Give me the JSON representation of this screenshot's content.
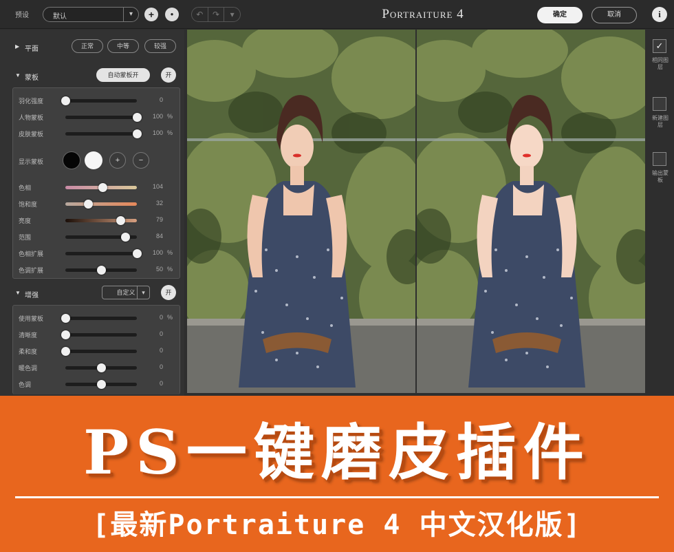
{
  "toolbar": {
    "preset_label": "预设",
    "preset_value": "默认",
    "preset_caret": "▾",
    "add_symbol": "+",
    "settings_symbol": "●",
    "undo_symbol": "↶",
    "redo_symbol": "↷",
    "history_symbol": "▾",
    "app_title": "Portraiture 4",
    "ok_label": "确定",
    "cancel_label": "取消",
    "info_symbol": "i"
  },
  "panel": {
    "tone": {
      "name": "平面",
      "buttons": [
        "正常",
        "中等",
        "较强"
      ]
    },
    "mask": {
      "name": "蒙板",
      "auto_button": "自动蒙板开",
      "toggle": "开",
      "sliders": [
        {
          "label": "羽化强度",
          "value": "0",
          "unit": "",
          "pos": 0.0
        },
        {
          "label": "人物蒙板",
          "value": "100",
          "unit": "%",
          "pos": 1.0
        },
        {
          "label": "皮肤蒙板",
          "value": "100",
          "unit": "%",
          "pos": 1.0
        }
      ],
      "show_mask_label": "显示蒙板",
      "picker_plus": "+",
      "picker_minus": "−",
      "color_sliders": [
        {
          "label": "色相",
          "value": "104",
          "unit": "",
          "pos": 0.52
        },
        {
          "label": "饱和度",
          "value": "32",
          "unit": "",
          "pos": 0.32
        },
        {
          "label": "亮度",
          "value": "79",
          "unit": "",
          "pos": 0.77
        },
        {
          "label": "范围",
          "value": "84",
          "unit": "",
          "pos": 0.84
        },
        {
          "label": "色相扩展",
          "value": "100",
          "unit": "%",
          "pos": 1.0
        },
        {
          "label": "色调扩展",
          "value": "50",
          "unit": "%",
          "pos": 0.5
        }
      ]
    },
    "enhance": {
      "name": "增强",
      "preset": "自定义",
      "caret": "▾",
      "toggle": "开",
      "sliders": [
        {
          "label": "使用蒙板",
          "value": "0",
          "unit": "%",
          "pos": 0.0
        },
        {
          "label": "清晰度",
          "value": "0",
          "unit": "",
          "pos": 0.0
        },
        {
          "label": "柔和度",
          "value": "0",
          "unit": "",
          "pos": 0.0
        },
        {
          "label": "暖色调",
          "value": "0",
          "unit": "",
          "pos": 0.5
        },
        {
          "label": "色调",
          "value": "0",
          "unit": "",
          "pos": 0.5
        }
      ]
    }
  },
  "right": {
    "items": [
      {
        "label": "相同图层",
        "checked": true,
        "mark": "✓"
      },
      {
        "label": "新建图层",
        "checked": false,
        "mark": ""
      },
      {
        "label": "输出蒙板",
        "checked": false,
        "mark": ""
      }
    ]
  },
  "banner": {
    "title": "PS一键磨皮插件",
    "subtitle": "[最新Portraiture 4 中文汉化版]"
  },
  "colors": {
    "accent": "#e8661e",
    "panel": "#323232"
  }
}
